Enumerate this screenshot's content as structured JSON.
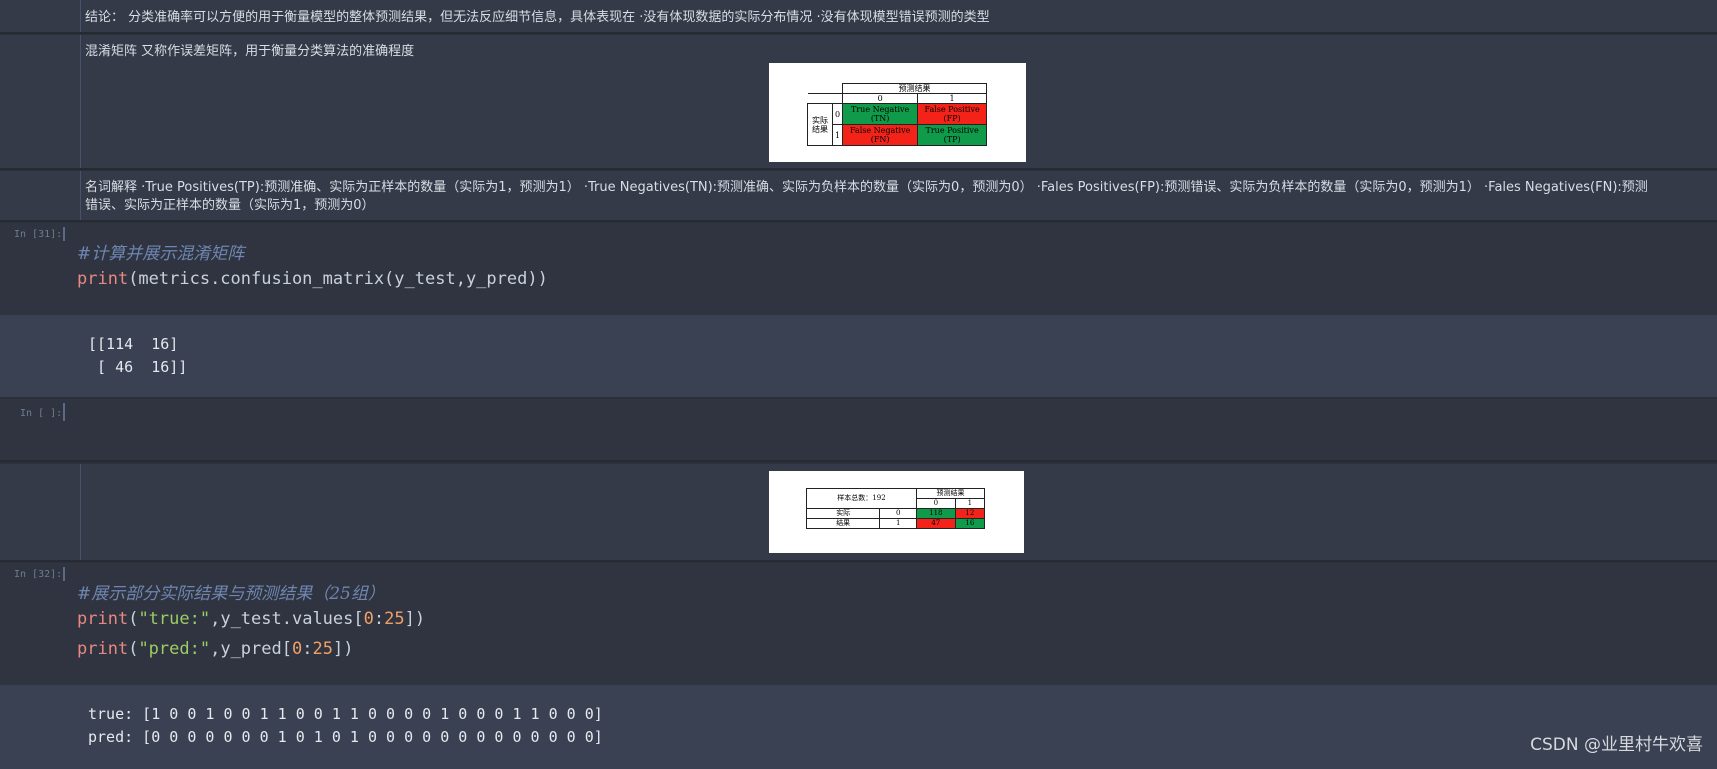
{
  "cells": {
    "md_conclusion": "结论：  分类准确率可以方便的用于衡量模型的整体预测结果，但无法反应细节信息，具体表现在 ·没有体现数据的实际分布情况 ·没有体现模型错误预测的类型",
    "md_confusion": "混淆矩阵 又称作误差矩阵，用于衡量分类算法的准确程度",
    "md_terms_line1": "名词解释 ·True Positives(TP):预测准确、实际为正样本的数量（实际为1，预测为1） ·True Negatives(TN):预测准确、实际为负样本的数量（实际为0，预测为0） ·Fales Positives(FP):预测错误、实际为负样本的数量（实际为0，预测为1） ·Fales Negatives(FN):预测",
    "md_terms_line2": "错误、实际为正样本的数量（实际为1，预测为0）",
    "code31": {
      "prompt": "In [31]:",
      "comment": "#计算并展示混淆矩阵",
      "print_kw": "print",
      "line2_rest": "(metrics.confusion_matrix(y_test,y_pred))",
      "output_line1": "[[114  16]",
      "output_line2": " [ 46  16]]"
    },
    "code_empty": {
      "prompt": "In [ ]:"
    },
    "code32": {
      "prompt": "In [32]:",
      "comment": "#展示部分实际结果与预测结果（25组）",
      "print_kw": "print",
      "l2_open": "(",
      "l2_str": "\"true:\"",
      "l2_mid": ",y_test.values[",
      "l2_n1": "0",
      "l2_colon": ":",
      "l2_n2": "25",
      "l2_close": "])",
      "l3_open": "(",
      "l3_str": "\"pred:\"",
      "l3_mid": ",y_pred[",
      "l3_n1": "0",
      "l3_colon": ":",
      "l3_n2": "25",
      "l3_close": "])",
      "output_line1": "true: [1 0 0 1 0 0 1 1 0 0 1 1 0 0 0 0 1 0 0 0 1 1 0 0 0]",
      "output_line2": "pred: [0 0 0 0 0 0 0 1 0 1 0 1 0 0 0 0 0 0 0 0 0 0 0 0 0]"
    }
  },
  "matrix1": {
    "header": "预测结果",
    "col0": "0",
    "col1": "1",
    "row_label": "实际结果",
    "row0": "0",
    "row1": "1",
    "tn": "True Negative (TN)",
    "fp": "False Positive (FP)",
    "fn": "False Negative (FN)",
    "tp": "True Positive (TP)"
  },
  "matrix2": {
    "corner": "样本总数：192",
    "header": "预测结果",
    "col0": "0",
    "col1": "1",
    "row_label_a": "实际",
    "row_label_b": "结果",
    "row0": "0",
    "row1": "1",
    "v00": "118",
    "v01": "12",
    "v10": "47",
    "v11": "16"
  },
  "colors": {
    "green": "#0f9b4a",
    "red": "#f4231a"
  },
  "watermark": "CSDN @业里村牛欢喜"
}
